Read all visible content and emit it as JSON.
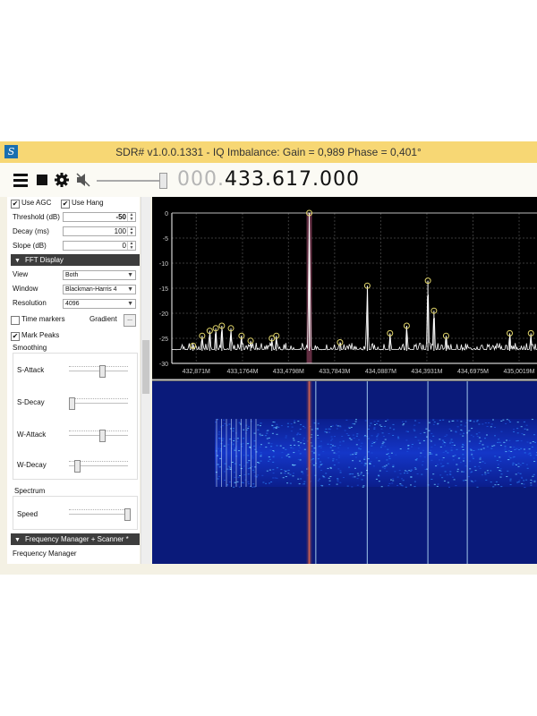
{
  "window": {
    "title": "SDR# v1.0.0.1331 - IQ Imbalance: Gain = 0,989 Phase = 0,401°",
    "app_icon": "sdr-app-icon"
  },
  "toolbar": {
    "icons": [
      "menu-icon",
      "stop-icon",
      "settings-gear-icon",
      "mute-speaker-icon"
    ],
    "audio_gain_level": 0.95,
    "frequency_dim": "000.",
    "frequency_main": "433.617.000"
  },
  "panel": {
    "use_agc": {
      "label": "Use AGC",
      "checked": true
    },
    "use_hang": {
      "label": "Use Hang",
      "checked": true
    },
    "threshold": {
      "label": "Threshold (dB)",
      "value": "-50"
    },
    "decay": {
      "label": "Decay (ms)",
      "value": "100"
    },
    "slope": {
      "label": "Slope (dB)",
      "value": "0"
    },
    "fft_section": "FFT Display",
    "view": {
      "label": "View",
      "value": "Both"
    },
    "window": {
      "label": "Window",
      "value": "Blackman-Harris 4"
    },
    "resolution": {
      "label": "Resolution",
      "value": "4096"
    },
    "time_markers": {
      "label": "Time markers",
      "checked": false
    },
    "gradient": {
      "label": "Gradient",
      "button": "..."
    },
    "mark_peaks": {
      "label": "Mark Peaks",
      "checked": true
    },
    "smoothing": {
      "title": "Smoothing",
      "s_attack": {
        "label": "S-Attack",
        "level": 0.55
      },
      "s_decay": {
        "label": "S-Decay",
        "level": 0.0
      },
      "w_attack": {
        "label": "W-Attack",
        "level": 0.55
      },
      "w_decay": {
        "label": "W-Decay",
        "level": 0.1
      }
    },
    "spectrum": {
      "title": "Spectrum",
      "speed": {
        "label": "Speed",
        "level": 1.0
      }
    },
    "freq_manager_section": "Frequency Manager + Scanner *",
    "freq_manager_label": "Frequency Manager"
  },
  "chart_data": {
    "type": "line",
    "title": "",
    "xlabel": "",
    "ylabel": "",
    "y_ticks": [
      0,
      -5,
      -10,
      -15,
      -20,
      -25,
      -30
    ],
    "ylim": [
      -30,
      0
    ],
    "x_tick_labels": [
      "432,871M",
      "433,1764M",
      "433,4798M",
      "433,7843M",
      "434,0887M",
      "434,3931M",
      "434,6975M",
      "435,0019M"
    ],
    "x_ticks_mhz": [
      432.871,
      433.1764,
      433.4798,
      433.7843,
      434.0887,
      434.3931,
      434.6975,
      435.0019
    ],
    "xlim_mhz": [
      432.71,
      435.12
    ],
    "center_frequency_mhz": 433.617,
    "noise_floor_db": -27.5,
    "peaks": [
      {
        "x": 432.85,
        "y": -26.5
      },
      {
        "x": 432.91,
        "y": -24.5
      },
      {
        "x": 432.96,
        "y": -23.5
      },
      {
        "x": 433.0,
        "y": -23.0
      },
      {
        "x": 433.04,
        "y": -22.5
      },
      {
        "x": 433.1,
        "y": -23.0
      },
      {
        "x": 433.17,
        "y": -24.5
      },
      {
        "x": 433.23,
        "y": -25.5
      },
      {
        "x": 433.37,
        "y": -25.0
      },
      {
        "x": 433.4,
        "y": -24.5
      },
      {
        "x": 433.617,
        "y": 0.0
      },
      {
        "x": 433.82,
        "y": -25.8
      },
      {
        "x": 434.0,
        "y": -14.5
      },
      {
        "x": 434.15,
        "y": -24.0
      },
      {
        "x": 434.26,
        "y": -22.5
      },
      {
        "x": 434.4,
        "y": -13.5
      },
      {
        "x": 434.44,
        "y": -19.5
      },
      {
        "x": 434.52,
        "y": -24.5
      },
      {
        "x": 434.94,
        "y": -24.0
      },
      {
        "x": 435.08,
        "y": -24.0
      }
    ],
    "grid": true,
    "legend": "none",
    "colors": {
      "trace": "#ffffff",
      "peak_marker": "#e2d66a",
      "center_line": "#ff7a55",
      "center_band": "#7a3a52",
      "waterfall_background": "#0a1a7a"
    },
    "waterfall": {
      "active_band_db_range": [
        -30,
        -10
      ],
      "bright_lines_mhz": [
        433.617,
        433.66,
        434.0,
        434.4,
        434.66
      ]
    }
  }
}
